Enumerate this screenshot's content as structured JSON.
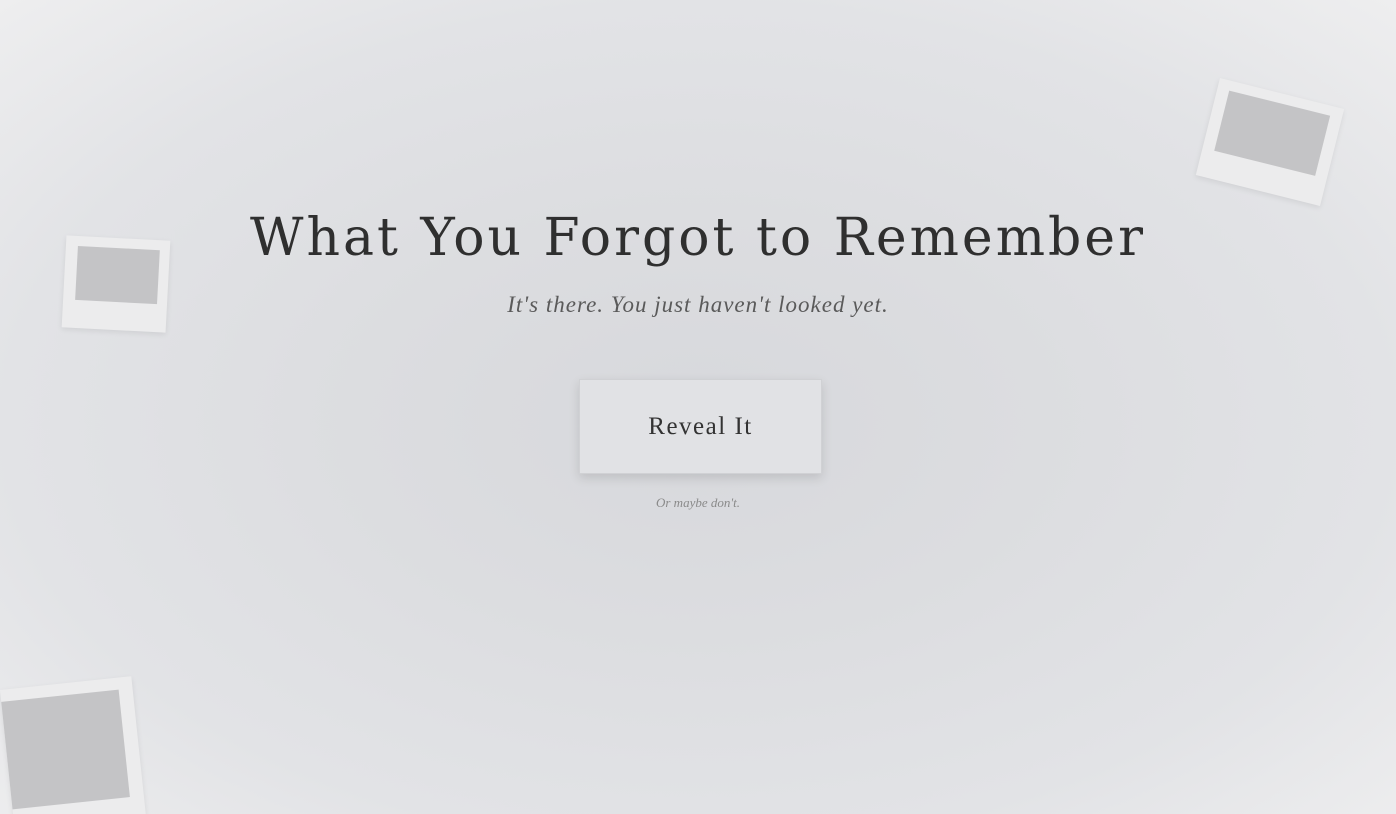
{
  "hero": {
    "title": "What You Forgot to Remember",
    "subtitle": "It's there. You just haven't looked yet.",
    "cta_label": "Reveal It",
    "dismiss_text": "Or maybe don't."
  },
  "decor": {
    "polaroid_frame_color": "#ececed",
    "polaroid_photo_color": "#c4c4c6"
  }
}
